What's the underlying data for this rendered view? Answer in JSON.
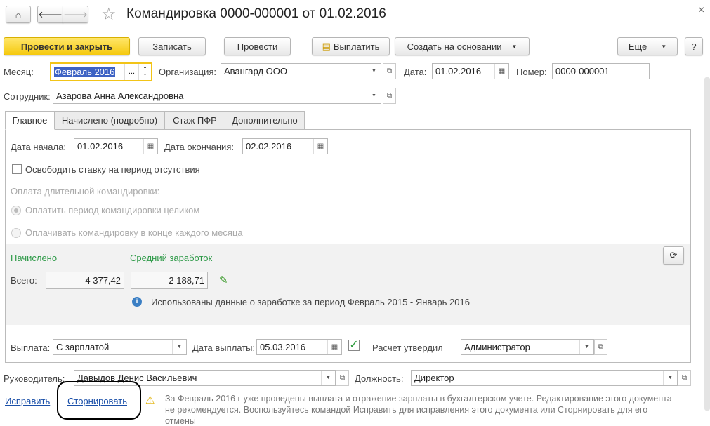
{
  "header": {
    "title": "Командировка 0000-000001 от 01.02.2016",
    "home_icon": "home-icon",
    "back_icon": "arrow-left-icon",
    "forward_icon": "arrow-right-icon",
    "star_icon": "star-icon",
    "close": "×"
  },
  "toolbar": {
    "post_close": "Провести и закрыть",
    "save": "Записать",
    "post": "Провести",
    "pay": "Выплатить",
    "create_based": "Создать на основании",
    "more": "Еще",
    "help": "?"
  },
  "fields": {
    "month_label": "Месяц:",
    "month_value": "Февраль 2016",
    "month_ellipsis": "...",
    "org_label": "Организация:",
    "org_value": "Авангард ООО",
    "date_label": "Дата:",
    "date_value": "01.02.2016",
    "number_label": "Номер:",
    "number_value": "0000-000001",
    "employee_label": "Сотрудник:",
    "employee_value": "Азарова Анна Александровна"
  },
  "tabs": [
    "Главное",
    "Начислено (подробно)",
    "Стаж ПФР",
    "Дополнительно"
  ],
  "main": {
    "start_label": "Дата начала:",
    "start_value": "01.02.2016",
    "end_label": "Дата окончания:",
    "end_value": "02.02.2016",
    "free_rate": "Освободить ставку на период отсутствия",
    "free_rate_checked": false,
    "long_trip_label": "Оплата длительной командировки:",
    "radio1": "Оплатить период командировки целиком",
    "radio2": "Оплачивать командировку в конце каждого месяца",
    "accrued_label": "Начислено",
    "avg_label": "Средний заработок",
    "total_label": "Всего:",
    "total_value": "4 377,42",
    "avg_value": "2 188,71",
    "info": "Использованы данные о заработке за период Февраль 2015 - Январь 2016",
    "payout_label": "Выплата:",
    "payout_value": "С зарплатой",
    "payout_date_label": "Дата выплаты:",
    "payout_date_value": "05.03.2016",
    "approved_label": "Расчет утвердил",
    "approved_checked": true,
    "approved_value": "Администратор"
  },
  "footer": {
    "head_label": "Руководитель:",
    "head_value": "Давыдов Денис Васильевич",
    "position_label": "Должность:",
    "position_value": "Директор",
    "fix_link": "Исправить",
    "storno_link": "Сторнировать",
    "warning_line1": "За Февраль 2016 г уже проведены выплата и отражение зарплаты в бухгалтерском учете. Редактирование этого документа",
    "warning_line2": "не рекомендуется. Воспользуйтесь командой Исправить для исправления этого документа или Сторнировать для его",
    "warning_line3": "отмены"
  },
  "colors": {
    "accent_yellow": "#f5c90e",
    "green_label": "#2e9a48",
    "link": "#1a4fa8",
    "selection": "#3d62c4"
  }
}
